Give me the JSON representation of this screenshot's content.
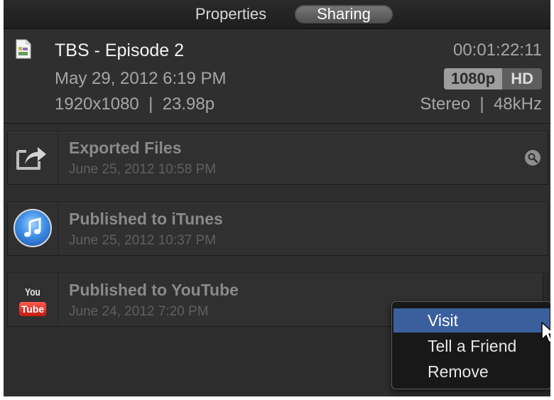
{
  "tabs": {
    "properties": "Properties",
    "sharing": "Sharing",
    "active": "Sharing"
  },
  "clip": {
    "title": "TBS - Episode 2",
    "date": "May 29, 2012 6:19 PM",
    "resolution_line": "1920x1080  |  23.98p",
    "timecode": "00:01:22:11",
    "format_badge": "1080p",
    "hd_badge": "HD",
    "audio": "Stereo  |  48kHz",
    "icon": "document-icon"
  },
  "share_rows": [
    {
      "title": "Exported Files",
      "date": "June 25, 2012 10:58 PM",
      "icon": "export-icon",
      "action_icon": "magnifier-icon"
    },
    {
      "title": "Published to iTunes",
      "date": "June 25, 2012 10:37 PM",
      "icon": "itunes-icon"
    },
    {
      "title": "Published to YouTube",
      "date": "June 24, 2012 7:20 PM",
      "icon": "youtube-icon",
      "icon_text_top": "You",
      "icon_text_bottom": "Tube"
    }
  ],
  "menu": {
    "items": [
      "Visit",
      "Tell a Friend",
      "Remove"
    ],
    "highlighted": "Visit"
  },
  "colors": {
    "panel_bg": "#2e2e2e",
    "menu_highlight": "#3a5f9c",
    "youtube_red": "#d9261c"
  }
}
